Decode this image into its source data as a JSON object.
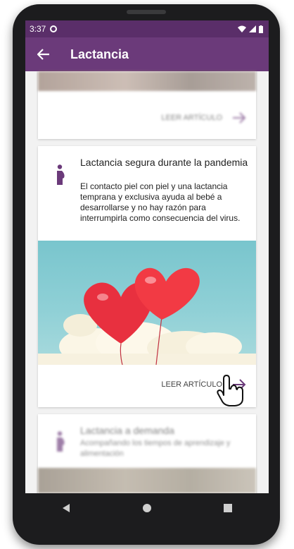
{
  "status": {
    "time": "3:37"
  },
  "appbar": {
    "title": "Lactancia"
  },
  "articles": [
    {
      "read_label": "LEER ARTÍCULO"
    },
    {
      "title": "Lactancia segura durante la pandemia",
      "description": "El contacto piel con piel y una lactancia temprana y exclusiva ayuda al bebé a desarrollarse y no hay razón para interrumpirla como consecuencia del virus.",
      "read_label": "LEER ARTÍCULO"
    },
    {
      "title": "Lactancia a demanda",
      "description": "Acompañando los tiempos de aprendizaje y alimentación"
    }
  ],
  "colors": {
    "statusbar": "#5a2e69",
    "appbar": "#6b3a7a",
    "accent": "#6b3a7a"
  }
}
